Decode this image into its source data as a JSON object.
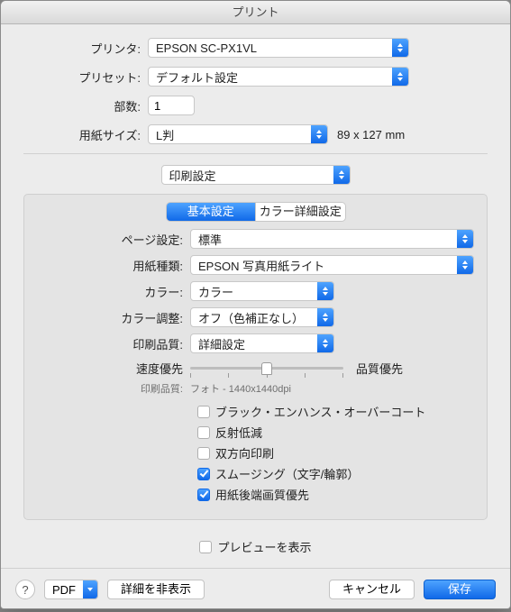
{
  "window": {
    "title": "プリント"
  },
  "top": {
    "printer_label": "プリンタ:",
    "printer_value": "EPSON SC-PX1VL",
    "preset_label": "プリセット:",
    "preset_value": "デフォルト設定",
    "copies_label": "部数:",
    "copies_value": "1",
    "paper_size_label": "用紙サイズ:",
    "paper_size_value": "L判",
    "paper_size_dim": "89 x 127 mm",
    "section_value": "印刷設定"
  },
  "tabs": {
    "basic": "基本設定",
    "advanced": "カラー詳細設定",
    "active": "basic"
  },
  "settings": {
    "page_label": "ページ設定:",
    "page_value": "標準",
    "media_label": "用紙種類:",
    "media_value": "EPSON 写真用紙ライト",
    "color_label": "カラー:",
    "color_value": "カラー",
    "cadjust_label": "カラー調整:",
    "cadjust_value": "オフ（色補正なし）",
    "quality_label": "印刷品質:",
    "quality_value": "詳細設定",
    "speed_label": "速度優先",
    "quality_right": "品質優先",
    "quality_hint_label": "印刷品質:",
    "quality_hint_value": "フォト - 1440x1440dpi",
    "checks": {
      "black_enhance": {
        "label": "ブラック・エンハンス・オーバーコート",
        "checked": false
      },
      "ref_reduce": {
        "label": "反射低減",
        "checked": false
      },
      "bidir": {
        "label": "双方向印刷",
        "checked": false
      },
      "smoothing": {
        "label": "スムージング（文字/輪郭）",
        "checked": true
      },
      "trailing_edge": {
        "label": "用紙後端画質優先",
        "checked": true
      }
    }
  },
  "preview": {
    "label": "プレビューを表示",
    "checked": false
  },
  "footer": {
    "pdf": "PDF",
    "details": "詳細を非表示",
    "cancel": "キャンセル",
    "save": "保存"
  }
}
